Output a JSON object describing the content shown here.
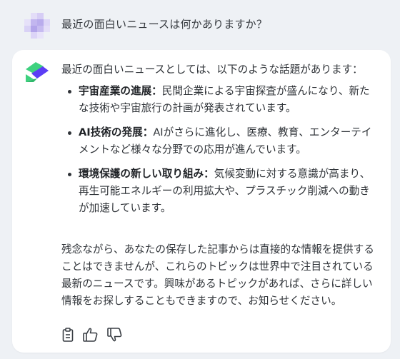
{
  "user": {
    "message": "最近の面白いニュースは何かありますか？"
  },
  "answer": {
    "intro": "最近の面白いニュースとしては、以下のような話題があります：",
    "topics": [
      {
        "title": "宇宙産業の進展",
        "separator": "：",
        "body": "民間企業による宇宙探査が盛んになり、新たな技術や宇宙旅行の計画が発表されています。"
      },
      {
        "title": "AI技術の発展",
        "separator": "：",
        "body": "AIがさらに進化し、医療、教育、エンターテイメントなど様々な分野での応用が進んでいます。"
      },
      {
        "title": "環境保護の新しい取り組み",
        "separator": "：",
        "body": "気候変動に対する意識が高まり、再生可能エネルギーの利用拡大や、プラスチック削減への動きが加速しています。"
      }
    ],
    "closing": "残念ながら、あなたの保存した記事からは直接的な情報を提供することはできませんが、これらのトピックは世界中で注目されている最新のニュースです。興味があるトピックがあれば、さらに詳しい情報をお探しすることもできますので、お知らせください。"
  },
  "actions": [
    {
      "icon": "clipboard-icon"
    },
    {
      "icon": "thumbs-up-icon"
    },
    {
      "icon": "thumbs-down-icon"
    }
  ],
  "colors": {
    "background": "#eef1f5",
    "card": "#ffffff",
    "bot_green": "#3fd17f",
    "bot_purple": "#5b3df5",
    "user_avatar_lavender": "#c9bff0"
  }
}
